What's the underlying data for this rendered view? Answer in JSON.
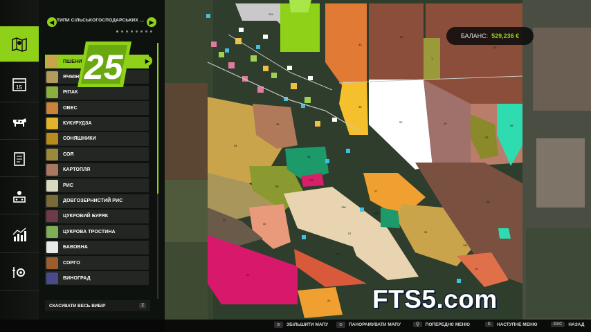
{
  "panel": {
    "title": "ТИПИ СІЛЬСЬКОГОСПОДАРСЬКИХ КУЛЬТУ...",
    "clear_label": "СКАСУВАТИ ВЕСЬ ВИБІР",
    "clear_key": "Z",
    "crops": [
      {
        "label": "ПШЕНИЦЯ",
        "color": "#c9a44a",
        "selected": true
      },
      {
        "label": "ЯЧМІНЬ",
        "color": "#b59a5e",
        "selected": false
      },
      {
        "label": "РІПАК",
        "color": "#8cae3c",
        "selected": false
      },
      {
        "label": "ОВЕС",
        "color": "#c9843a",
        "selected": false
      },
      {
        "label": "КУКУРУДЗА",
        "color": "#e2b42b",
        "selected": false
      },
      {
        "label": "СОНЯШНИКИ",
        "color": "#b88b1f",
        "selected": false
      },
      {
        "label": "СОЯ",
        "color": "#9c8a3a",
        "selected": false
      },
      {
        "label": "КАРТОПЛЯ",
        "color": "#a87860",
        "selected": false
      },
      {
        "label": "РИС",
        "color": "#d9d9c0",
        "selected": false
      },
      {
        "label": "ДОВГОЗЕРНИСТИЙ РИС",
        "color": "#7a6a3a",
        "selected": false
      },
      {
        "label": "ЦУКРОВИЙ БУРЯК",
        "color": "#6e3a4a",
        "selected": false
      },
      {
        "label": "ЦУКРОВА ТРОСТИНА",
        "color": "#7fae5a",
        "selected": false
      },
      {
        "label": "БАВОВНА",
        "color": "#e8e8e8",
        "selected": false
      },
      {
        "label": "СОРГО",
        "color": "#9a5e2e",
        "selected": false
      },
      {
        "label": "ВИНОГРАД",
        "color": "#4a4a8a",
        "selected": false
      }
    ]
  },
  "logo": {
    "text": "25"
  },
  "balance": {
    "label": "БАЛАНС:",
    "value": "529,236 €"
  },
  "watermark": "FTS5.com",
  "bottom_hints": [
    {
      "key": "⊙",
      "label": "ЗБІЛЬШИТИ МАПУ"
    },
    {
      "key": "⊙",
      "label": "ПАНОРАМУВАТИ МАПУ"
    },
    {
      "key": "Q",
      "label": "ПОПЕРЕДНЄ МЕНЮ"
    },
    {
      "key": "E",
      "label": "НАСТУПНЕ МЕНЮ"
    },
    {
      "key": "ESC",
      "label": "НАЗАД"
    }
  ],
  "nav": [
    "map-icon",
    "calendar-icon",
    "animals-icon",
    "contracts-icon",
    "production-icon",
    "statistics-icon",
    "settings-icon"
  ],
  "calendar_day": "15",
  "fields": [
    "134",
    "33",
    "52",
    "22",
    "53",
    "26",
    "54",
    "50",
    "27",
    "37",
    "30",
    "28",
    "55",
    "57",
    "21",
    "40",
    "36",
    "24",
    "16",
    "96",
    "23",
    "19",
    "35",
    "25",
    "139",
    "32",
    "143",
    "20",
    "31",
    "38",
    "129",
    "34",
    "136",
    "133",
    "128",
    "141",
    "49",
    "142",
    "1"
  ]
}
